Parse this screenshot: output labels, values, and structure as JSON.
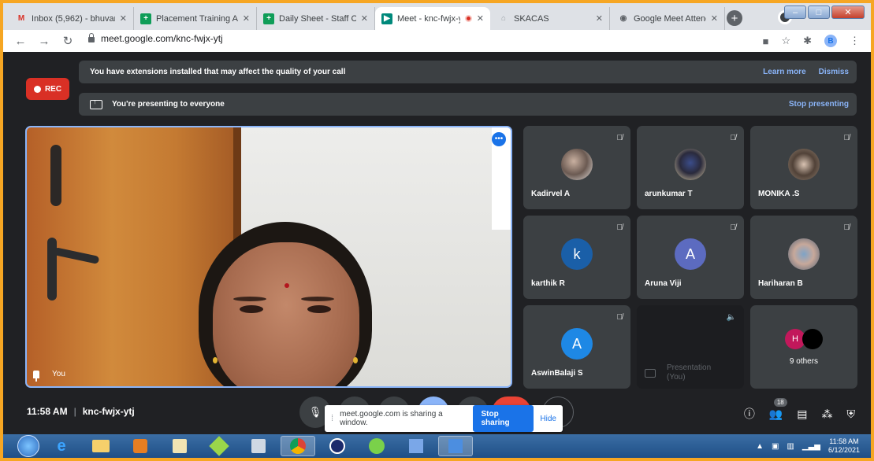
{
  "browser": {
    "tabs": [
      {
        "title": "Inbox (5,962) - bhuvan",
        "icon": "gmail-icon",
        "glyph": "M",
        "color": "#d93025"
      },
      {
        "title": "Placement Training Att",
        "icon": "sheets-icon",
        "glyph": "+",
        "color": "#0f9d58"
      },
      {
        "title": "Daily Sheet - Staff Class",
        "icon": "sheets-icon",
        "glyph": "+",
        "color": "#0f9d58"
      },
      {
        "title": "Meet - knc-fwjx-ytj",
        "icon": "meet-icon",
        "glyph": "▶",
        "color": "#00897b",
        "active": true
      },
      {
        "title": "SKACAS",
        "icon": "site-icon",
        "glyph": "⌂",
        "color": "#9aa0a6"
      },
      {
        "title": "Google Meet Attendan",
        "icon": "chrome-icon",
        "glyph": "◉",
        "color": "#5f6368"
      }
    ],
    "close_glyph": "✕",
    "new_tab": "+",
    "url": "meet.google.com/knc-fwjx-ytj",
    "profile_initial": "B"
  },
  "meet": {
    "rec_label": "REC",
    "ext_banner": {
      "text": "You have extensions installed that may affect the quality of your call",
      "learn_more": "Learn more",
      "dismiss": "Dismiss"
    },
    "presenting_banner": {
      "text": "You're presenting to everyone",
      "stop": "Stop presenting"
    },
    "self_label": "You",
    "participants": [
      {
        "name": "Kadirvel A",
        "avatar": "photo1"
      },
      {
        "name": "arunkumar T",
        "avatar": "photo2"
      },
      {
        "name": "MONIKA .S",
        "avatar": "photo3"
      },
      {
        "name": "karthik R",
        "initial": "k",
        "color": "#1a5fa8"
      },
      {
        "name": "Aruna Viji",
        "initial": "A",
        "color": "#5c6bc0"
      },
      {
        "name": "Hariharan B",
        "avatar": "photo4"
      },
      {
        "name": "AswinBalaji S",
        "initial": "A",
        "color": "#1e88e5"
      }
    ],
    "presentation_tile": {
      "line1": "Presentation",
      "line2": "(You)"
    },
    "others_tile": {
      "label": "9 others",
      "initial": "H",
      "color": "#c2185b"
    },
    "time": "11:58 AM",
    "sep": "|",
    "meeting_code": "knc-fwjx-ytj",
    "share_popup": {
      "text": "meet.google.com is sharing a window.",
      "stop": "Stop sharing",
      "hide": "Hide"
    },
    "people_count": "18"
  },
  "taskbar": {
    "time": "11:58 AM",
    "date": "6/12/2021"
  }
}
